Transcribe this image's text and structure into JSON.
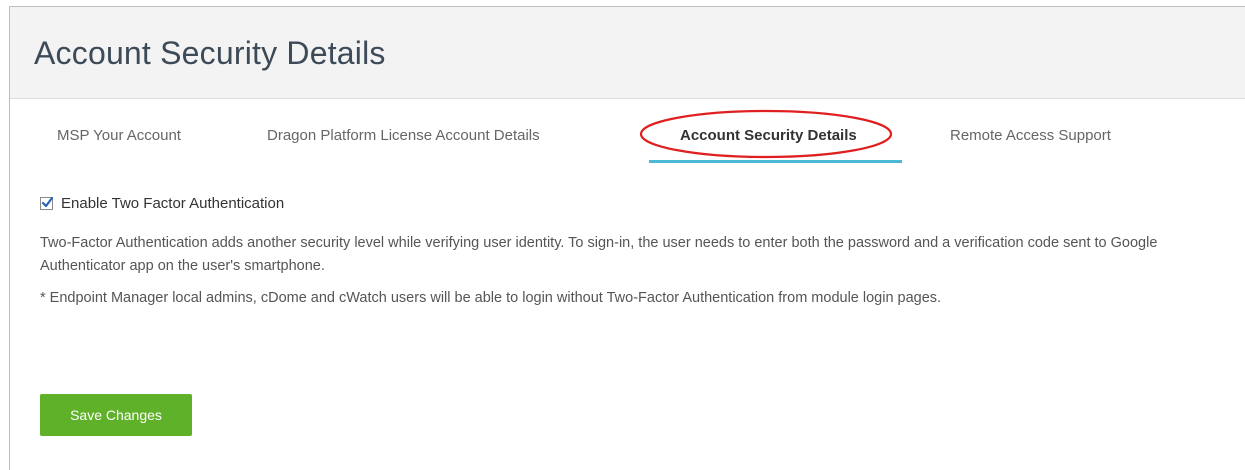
{
  "header": {
    "title": "Account Security Details"
  },
  "tabs": [
    {
      "label": "MSP Your Account",
      "active": false
    },
    {
      "label": "Dragon Platform License Account Details",
      "active": false
    },
    {
      "label": "Account Security Details",
      "active": true
    },
    {
      "label": "Remote Access Support",
      "active": false
    }
  ],
  "security": {
    "two_factor_label": "Enable Two Factor Authentication",
    "two_factor_checked": true,
    "description": "Two-Factor Authentication adds another security level while verifying user identity. To sign-in, the user needs to enter both the password and a verification code sent to Google Authenticator app on the user's smartphone.",
    "note": "* Endpoint Manager local admins, cDome and cWatch users will be able to login without Two-Factor Authentication from module login pages."
  },
  "actions": {
    "save_label": "Save Changes"
  },
  "colors": {
    "header_bg": "#f3f3f3",
    "tab_underline": "#4db8d6",
    "highlight": "#e02020",
    "save_button": "#5fb12a"
  }
}
